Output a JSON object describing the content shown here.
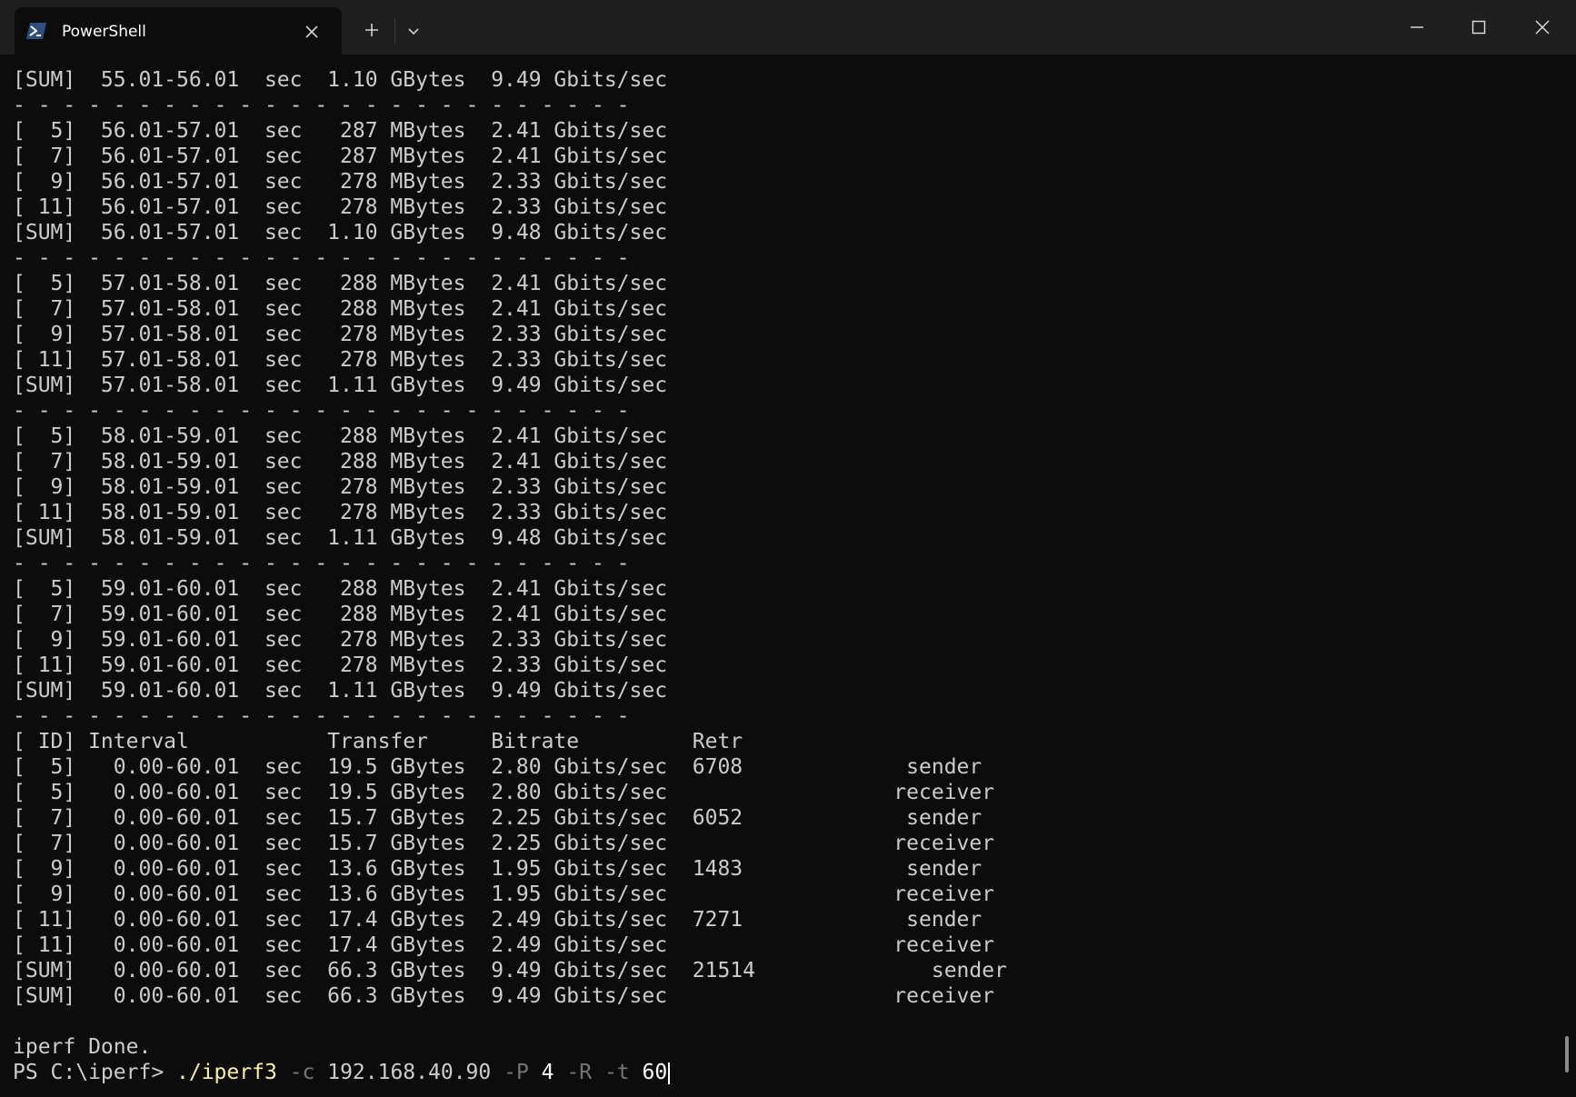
{
  "window": {
    "tab_title": "PowerShell",
    "icons": {
      "tab_icon": "powershell-icon",
      "tab_close": "close-icon",
      "new_tab": "plus-icon",
      "dropdown": "chevron-down-icon",
      "minimize": "minimize-icon",
      "maximize": "maximize-icon",
      "close": "close-icon"
    },
    "colors": {
      "titlebar": "#1f1f1f",
      "tab": "#0c0c0c",
      "terminal_bg": "#0c0c0c",
      "terminal_fg": "#cccccc",
      "command_exe": "#f9f1a5",
      "command_param": "#767676"
    }
  },
  "terminal": {
    "lines": [
      "[SUM]  55.01-56.01  sec  1.10 GBytes  9.49 Gbits/sec",
      "- - - - - - - - - - - - - - - - - - - - - - - - -",
      "[  5]  56.01-57.01  sec   287 MBytes  2.41 Gbits/sec",
      "[  7]  56.01-57.01  sec   287 MBytes  2.41 Gbits/sec",
      "[  9]  56.01-57.01  sec   278 MBytes  2.33 Gbits/sec",
      "[ 11]  56.01-57.01  sec   278 MBytes  2.33 Gbits/sec",
      "[SUM]  56.01-57.01  sec  1.10 GBytes  9.48 Gbits/sec",
      "- - - - - - - - - - - - - - - - - - - - - - - - -",
      "[  5]  57.01-58.01  sec   288 MBytes  2.41 Gbits/sec",
      "[  7]  57.01-58.01  sec   288 MBytes  2.41 Gbits/sec",
      "[  9]  57.01-58.01  sec   278 MBytes  2.33 Gbits/sec",
      "[ 11]  57.01-58.01  sec   278 MBytes  2.33 Gbits/sec",
      "[SUM]  57.01-58.01  sec  1.11 GBytes  9.49 Gbits/sec",
      "- - - - - - - - - - - - - - - - - - - - - - - - -",
      "[  5]  58.01-59.01  sec   288 MBytes  2.41 Gbits/sec",
      "[  7]  58.01-59.01  sec   288 MBytes  2.41 Gbits/sec",
      "[  9]  58.01-59.01  sec   278 MBytes  2.33 Gbits/sec",
      "[ 11]  58.01-59.01  sec   278 MBytes  2.33 Gbits/sec",
      "[SUM]  58.01-59.01  sec  1.11 GBytes  9.48 Gbits/sec",
      "- - - - - - - - - - - - - - - - - - - - - - - - -",
      "[  5]  59.01-60.01  sec   288 MBytes  2.41 Gbits/sec",
      "[  7]  59.01-60.01  sec   288 MBytes  2.41 Gbits/sec",
      "[  9]  59.01-60.01  sec   278 MBytes  2.33 Gbits/sec",
      "[ 11]  59.01-60.01  sec   278 MBytes  2.33 Gbits/sec",
      "[SUM]  59.01-60.01  sec  1.11 GBytes  9.49 Gbits/sec",
      "- - - - - - - - - - - - - - - - - - - - - - - - -",
      "[ ID] Interval           Transfer     Bitrate         Retr",
      "[  5]   0.00-60.01  sec  19.5 GBytes  2.80 Gbits/sec  6708             sender",
      "[  5]   0.00-60.01  sec  19.5 GBytes  2.80 Gbits/sec                  receiver",
      "[  7]   0.00-60.01  sec  15.7 GBytes  2.25 Gbits/sec  6052             sender",
      "[  7]   0.00-60.01  sec  15.7 GBytes  2.25 Gbits/sec                  receiver",
      "[  9]   0.00-60.01  sec  13.6 GBytes  1.95 Gbits/sec  1483             sender",
      "[  9]   0.00-60.01  sec  13.6 GBytes  1.95 Gbits/sec                  receiver",
      "[ 11]   0.00-60.01  sec  17.4 GBytes  2.49 Gbits/sec  7271             sender",
      "[ 11]   0.00-60.01  sec  17.4 GBytes  2.49 Gbits/sec                  receiver",
      "[SUM]   0.00-60.01  sec  66.3 GBytes  9.49 Gbits/sec  21514              sender",
      "[SUM]   0.00-60.01  sec  66.3 GBytes  9.49 Gbits/sec                  receiver",
      "",
      "iperf Done."
    ],
    "prompt": {
      "ps_text": "PS C:\\iperf> ",
      "exe": "./iperf3",
      "flag_c": "-c",
      "host": "192.168.40.90",
      "flag_p": "-P",
      "streams": "4",
      "flag_r": "-R",
      "flag_t": "-t",
      "time": "60"
    }
  }
}
